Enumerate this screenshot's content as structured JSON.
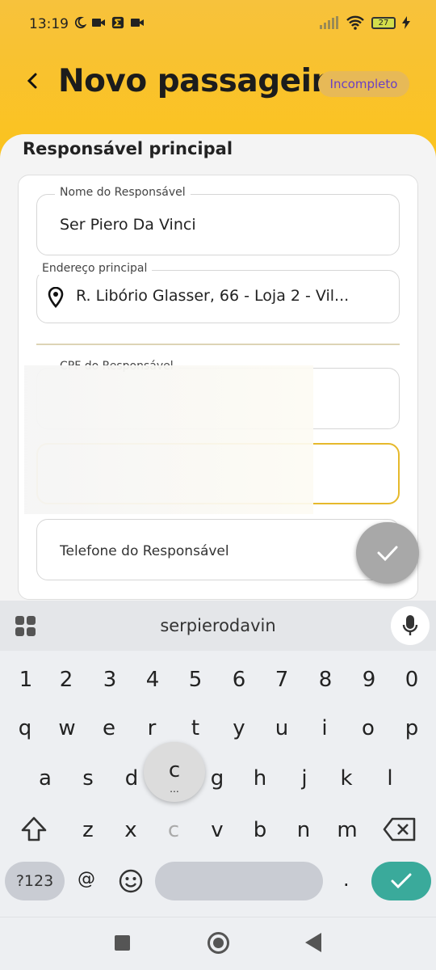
{
  "status_bar": {
    "time": "13:19",
    "battery": "27"
  },
  "header": {
    "back_icon": "arrow-back-icon",
    "title": "Novo passageiro",
    "badge": "Incompleto"
  },
  "section": {
    "title": "Responsável principal"
  },
  "form": {
    "name": {
      "label": "Nome do Responsável",
      "value": "Ser Piero Da Vinci"
    },
    "address": {
      "label": "Endereço principal",
      "value": "R. Libório Glasser, 66 - Loja 2 - Vil..."
    },
    "cpf": {
      "label": "CPF do Responsável"
    },
    "phone": {
      "placeholder": "Telefone do Responsável"
    }
  },
  "keyboard": {
    "suggestion": "serpierodavin",
    "digits": [
      "1",
      "2",
      "3",
      "4",
      "5",
      "6",
      "7",
      "8",
      "9",
      "0"
    ],
    "row1": [
      "q",
      "w",
      "e",
      "r",
      "t",
      "y",
      "u",
      "i",
      "o",
      "p"
    ],
    "row2": [
      "a",
      "s",
      "d",
      "c",
      "g",
      "h",
      "j",
      "k",
      "l"
    ],
    "row3": [
      "z",
      "x",
      "c",
      "v",
      "b",
      "n",
      "m"
    ],
    "popup_key": "c",
    "popup_hint": "...",
    "symbols_key": "?123",
    "at_key": "@",
    "period_key": "."
  },
  "colors": {
    "header_bg": "#fbc31d",
    "badge_bg": "#e7b957",
    "badge_text": "#6a3fc4",
    "accent_focus": "#e6b92c",
    "enter_key": "#3aaa9b"
  }
}
